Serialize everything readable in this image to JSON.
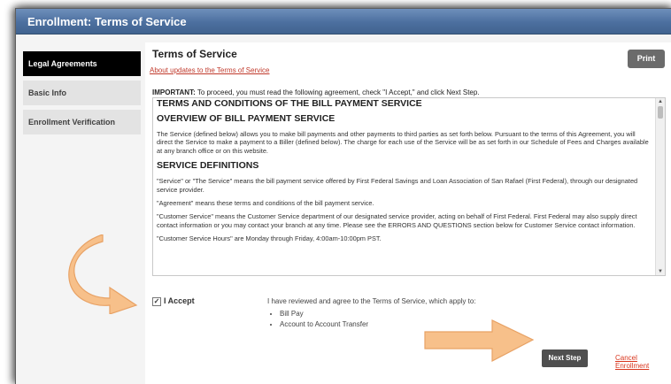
{
  "window": {
    "title": "Enrollment: Terms of Service"
  },
  "sidebar": {
    "items": [
      {
        "label": "Legal Agreements",
        "active": true
      },
      {
        "label": "Basic Info",
        "active": false
      },
      {
        "label": "Enrollment Verification",
        "active": false
      }
    ]
  },
  "main": {
    "heading": "Terms of Service",
    "updates_link": "About updates to the Terms of Service",
    "print_label": "Print",
    "important_label": "IMPORTANT:",
    "important_text": " To proceed, you must read the following agreement, check \"I Accept,\" and click Next Step.",
    "terms": {
      "title": "TERMS AND CONDITIONS OF THE BILL PAYMENT SERVICE",
      "overview_heading": "OVERVIEW OF BILL PAYMENT SERVICE",
      "overview_text": "The Service (defined below) allows you to make bill payments and other payments to third parties as set forth below. Pursuant to the terms of this Agreement, you will direct the Service to make a payment to a Biller (defined below). The charge for each use of the Service will be as set forth in our Schedule of Fees and Charges available at any branch office or on this website.",
      "definitions_heading": "SERVICE DEFINITIONS",
      "def1": "\"Service\" or \"The Service\" means the bill payment service offered by First Federal Savings and Loan Association of San Rafael (First Federal), through our designated service provider.",
      "def2": "\"Agreement\" means these terms and conditions of the bill payment service.",
      "def3": "\"Customer Service\" means the Customer Service department of our designated service provider, acting on behalf of First Federal. First Federal may also supply direct contact information or you may contact your branch at any time. Please see the ERRORS AND QUESTIONS section below for Customer Service contact information.",
      "def4": "\"Customer Service Hours\" are Monday through Friday, 4:00am-10:00pm PST."
    },
    "accept_label": "I Accept",
    "accept_checked": true,
    "agree_text": "I have reviewed and agree to the Terms of Service, which apply to:",
    "agree_items": [
      "Bill Pay",
      "Account to Account Transfer"
    ],
    "next_label": "Next Step",
    "cancel_label": "Cancel Enrollment"
  },
  "colors": {
    "titlebar": "#4c6f9f",
    "arrow_fill": "#f7c08a",
    "link": "#d9361e"
  }
}
